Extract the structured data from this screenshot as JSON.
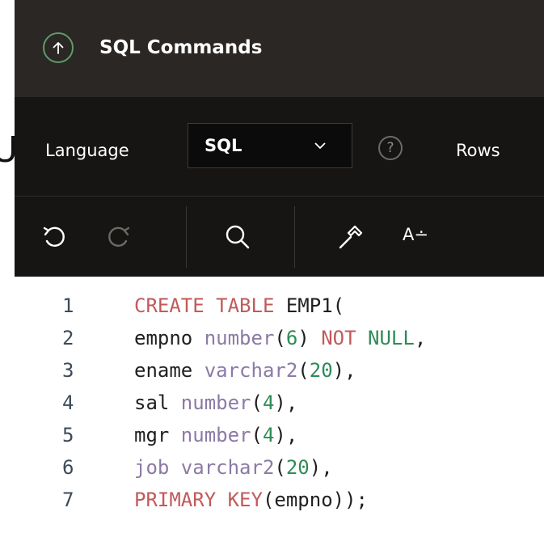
{
  "header": {
    "title": "SQL Commands",
    "icon": "arrow-up-circle-icon"
  },
  "toolbar": {
    "language_label": "Language",
    "language_value": "SQL",
    "help_glyph": "?",
    "rows_label": "Rows",
    "font_size_label": "A∸"
  },
  "editor": {
    "lines": [
      {
        "n": "1",
        "tokens": [
          {
            "t": "CREATE TABLE ",
            "c": "kw"
          },
          {
            "t": "EMP1",
            "c": "plain"
          },
          {
            "t": "(",
            "c": "punc"
          }
        ]
      },
      {
        "n": "2",
        "tokens": [
          {
            "t": "empno ",
            "c": "plain"
          },
          {
            "t": "number",
            "c": "type"
          },
          {
            "t": "(",
            "c": "punc"
          },
          {
            "t": "6",
            "c": "num"
          },
          {
            "t": ") ",
            "c": "punc"
          },
          {
            "t": "NOT ",
            "c": "kw"
          },
          {
            "t": "NULL",
            "c": "num"
          },
          {
            "t": ",",
            "c": "punc"
          }
        ]
      },
      {
        "n": "3",
        "tokens": [
          {
            "t": "ename ",
            "c": "plain"
          },
          {
            "t": "varchar2",
            "c": "type"
          },
          {
            "t": "(",
            "c": "punc"
          },
          {
            "t": "20",
            "c": "num"
          },
          {
            "t": "),",
            "c": "punc"
          }
        ]
      },
      {
        "n": "4",
        "tokens": [
          {
            "t": "sal ",
            "c": "plain"
          },
          {
            "t": "number",
            "c": "type"
          },
          {
            "t": "(",
            "c": "punc"
          },
          {
            "t": "4",
            "c": "num"
          },
          {
            "t": "),",
            "c": "punc"
          }
        ]
      },
      {
        "n": "5",
        "tokens": [
          {
            "t": "mgr ",
            "c": "plain"
          },
          {
            "t": "number",
            "c": "type"
          },
          {
            "t": "(",
            "c": "punc"
          },
          {
            "t": "4",
            "c": "num"
          },
          {
            "t": "),",
            "c": "punc"
          }
        ]
      },
      {
        "n": "6",
        "tokens": [
          {
            "t": "job ",
            "c": "type"
          },
          {
            "t": "varchar2",
            "c": "type"
          },
          {
            "t": "(",
            "c": "punc"
          },
          {
            "t": "20",
            "c": "num"
          },
          {
            "t": "),",
            "c": "punc"
          }
        ]
      },
      {
        "n": "7",
        "tokens": [
          {
            "t": "PRIMARY KEY",
            "c": "kw"
          },
          {
            "t": "(",
            "c": "punc"
          },
          {
            "t": "empno",
            "c": "plain"
          },
          {
            "t": "));",
            "c": "punc"
          }
        ]
      }
    ]
  },
  "colors": {
    "header_bg": "#2a2724",
    "toolbar_bg": "#161514",
    "keyword": "#c25a5a",
    "type": "#8b7aa6",
    "number": "#2e8b57",
    "accent_icon": "#5f9a6a"
  }
}
